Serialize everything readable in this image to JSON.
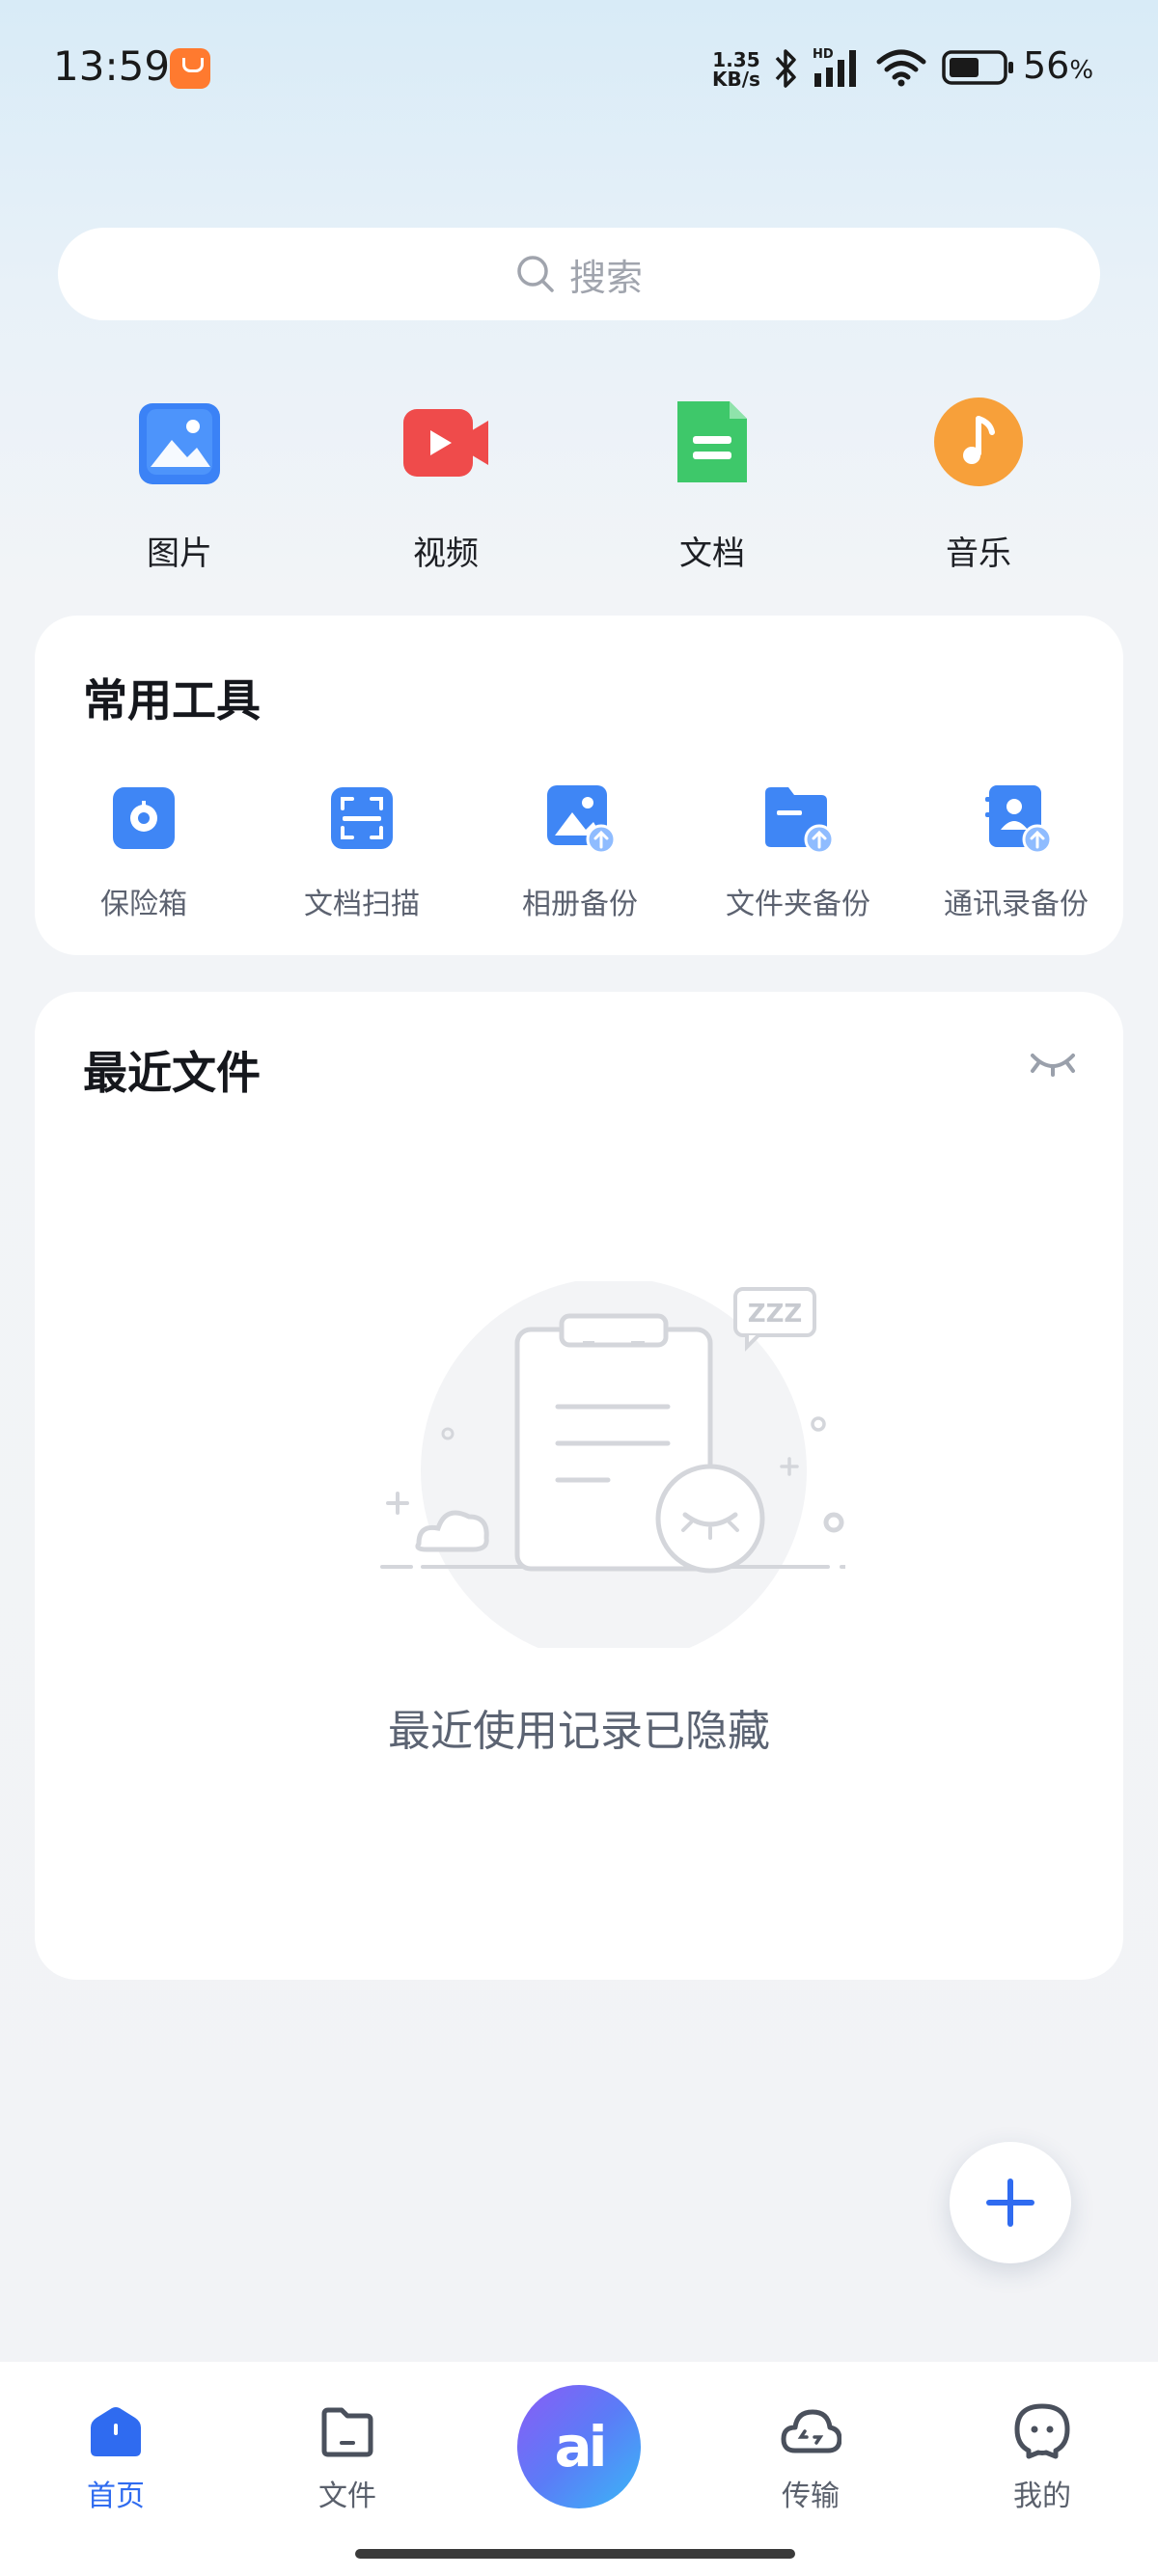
{
  "status_bar": {
    "time": "13:59",
    "net_speed_value": "1.35",
    "net_speed_unit": "KB/s",
    "signal_label": "HD",
    "battery_value": "56",
    "battery_unit": "%"
  },
  "search": {
    "placeholder": "搜索"
  },
  "categories": [
    {
      "label": "图片",
      "icon": "image-icon",
      "color": "#3b82f6"
    },
    {
      "label": "视频",
      "icon": "video-icon",
      "color": "#ef4b4b"
    },
    {
      "label": "文档",
      "icon": "document-icon",
      "color": "#3ec86a"
    },
    {
      "label": "音乐",
      "icon": "music-icon",
      "color": "#f7a03a"
    }
  ],
  "tools": {
    "title": "常用工具",
    "items": [
      {
        "label": "保险箱",
        "icon": "safe-icon"
      },
      {
        "label": "文档扫描",
        "icon": "scan-icon"
      },
      {
        "label": "相册备份",
        "icon": "album-backup-icon"
      },
      {
        "label": "文件夹备份",
        "icon": "folder-backup-icon"
      },
      {
        "label": "通讯录备份",
        "icon": "contacts-backup-icon"
      }
    ]
  },
  "recent": {
    "title": "最近文件",
    "empty_text": "最近使用记录已隐藏",
    "illustration_text": "ZZZ"
  },
  "fab": {
    "icon": "plus-icon",
    "color": "#2f6bf0"
  },
  "bottom_nav": {
    "items": [
      {
        "label": "首页",
        "icon": "home-icon",
        "active": true
      },
      {
        "label": "文件",
        "icon": "folder-icon",
        "active": false
      },
      {
        "label": "传输",
        "icon": "cloud-transfer-icon",
        "active": false
      },
      {
        "label": "我的",
        "icon": "profile-icon",
        "active": false
      }
    ],
    "ai_label": "ai"
  },
  "colors": {
    "accent": "#2f6bf0",
    "tool_blue": "#3f86f5"
  }
}
